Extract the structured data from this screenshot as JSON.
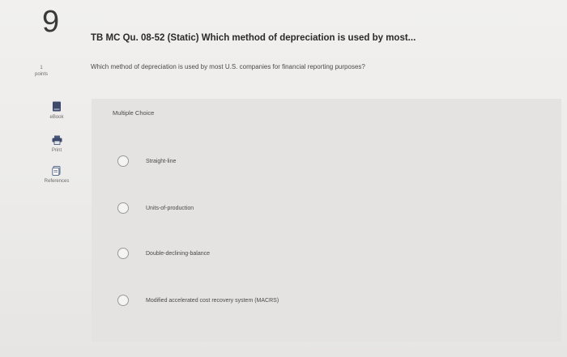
{
  "question_number": "9",
  "points": {
    "value": "1",
    "label": "points"
  },
  "tools": {
    "ebook": {
      "label": "eBook",
      "icon": "book-icon"
    },
    "print": {
      "label": "Print",
      "icon": "printer-icon"
    },
    "references": {
      "label": "References",
      "icon": "references-icon"
    }
  },
  "header": {
    "title": "TB MC Qu. 08-52 (Static) Which method of depreciation is used by most...",
    "question": "Which method of depreciation is used by most U.S. companies for financial reporting purposes?"
  },
  "choices": {
    "label": "Multiple Choice",
    "options": [
      {
        "label": "Straight-line"
      },
      {
        "label": "Units-of-production"
      },
      {
        "label": "Double-declining-balance"
      },
      {
        "label": "Modified accelerated cost recovery system (MACRS)"
      }
    ]
  },
  "colors": {
    "background": "#ecebea",
    "panel": "#e4e3e1",
    "ebook_icon": "#3d4a6b",
    "text": "#2b2b2b"
  }
}
